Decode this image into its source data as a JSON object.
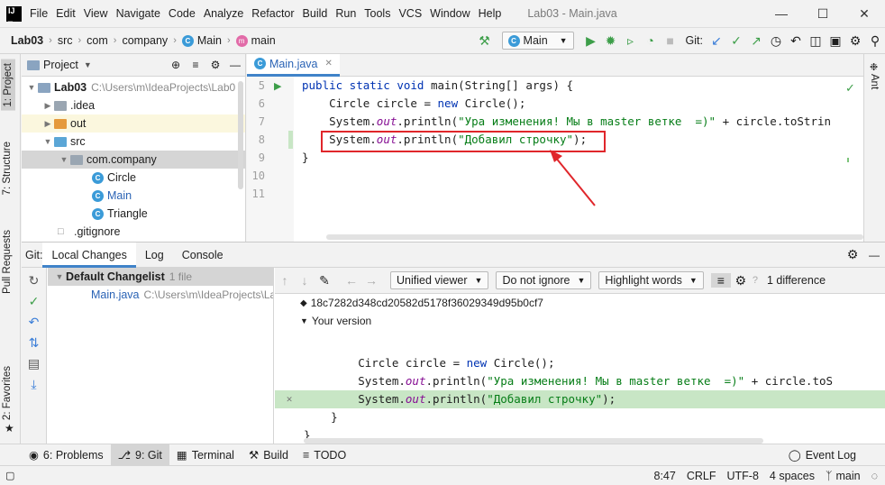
{
  "menubar": {
    "items": [
      "File",
      "Edit",
      "View",
      "Navigate",
      "Code",
      "Analyze",
      "Refactor",
      "Build",
      "Run",
      "Tools",
      "VCS",
      "Window",
      "Help"
    ],
    "window_title": "Lab03 - Main.java"
  },
  "navbar": {
    "crumbs": [
      "Lab03",
      "src",
      "com",
      "company",
      "Main",
      "main"
    ],
    "run_config": "Main",
    "git_label": "Git:"
  },
  "left_stripe": {
    "project": "1: Project",
    "structure": "7: Structure",
    "pull_requests": "Pull Requests",
    "favorites": "2: Favorites"
  },
  "right_stripe": {
    "ant": "Ant"
  },
  "project": {
    "title": "Project",
    "root": {
      "name": "Lab03",
      "path": "C:\\Users\\m\\IdeaProjects\\Lab0"
    },
    "items": {
      "idea": ".idea",
      "out": "out",
      "src": "src",
      "pkg": "com.company",
      "circle": "Circle",
      "main": "Main",
      "triangle": "Triangle",
      "gitignore": ".gitignore"
    }
  },
  "editor": {
    "tab": "Main.java",
    "line_numbers": [
      "5",
      "6",
      "7",
      "8",
      "9",
      "10",
      "11"
    ],
    "lines": {
      "l5_a": "public static void ",
      "l5_b": "main(String[] args) {",
      "l6_a": "    Circle circle = ",
      "l6_b": "new ",
      "l6_c": "Circle();",
      "l7_a": "    System.",
      "l7_b": "out",
      "l7_c": ".println(",
      "l7_d": "\"Ура изменения! Мы в master ветке  =)\"",
      "l7_e": " + circle.toStrin",
      "l8_a": "    System.",
      "l8_b": "out",
      "l8_c": ".println(",
      "l8_d": "\"Добавил строчку\"",
      "l8_e": ");",
      "l9": "}"
    }
  },
  "git": {
    "label": "Git:",
    "tabs": [
      "Local Changes",
      "Log",
      "Console"
    ],
    "changelist": {
      "name": "Default Changelist",
      "count": "1 file"
    },
    "file": {
      "name": "Main.java",
      "path": "C:\\Users\\m\\IdeaProjects\\Lab03"
    },
    "diff": {
      "viewer": "Unified viewer",
      "ignore": "Do not ignore",
      "highlight": "Highlight words",
      "differences": "1 difference",
      "hash": "18c7282d348cd20582d5178f36029349d95b0cf7",
      "version": "Your version",
      "lines": {
        "d1_a": "        Circle circle = ",
        "d1_b": "new ",
        "d1_c": "Circle();",
        "d2_a": "        System.",
        "d2_b": "out",
        "d2_c": ".println(",
        "d2_d": "\"Ура изменения! Мы в master ветке  =)\"",
        "d2_e": " + circle.toS",
        "d3_a": "        System.",
        "d3_b": "out",
        "d3_c": ".println(",
        "d3_d": "\"Добавил строчку\"",
        "d3_e": ");",
        "d4": "    }",
        "d5": "}"
      }
    }
  },
  "bottom_tabs": [
    "6: Problems",
    "9: Git",
    "Terminal",
    "Build",
    "TODO"
  ],
  "event_log": "Event Log",
  "status": {
    "position": "8:47",
    "line_sep": "CRLF",
    "encoding": "UTF-8",
    "indent": "4 spaces",
    "branch": "main"
  },
  "colors": {
    "highlight_box": "#e0262b",
    "added_line": "#c8e6c5",
    "accent": "#4083c9",
    "selected_row": "#d5d5d5"
  }
}
